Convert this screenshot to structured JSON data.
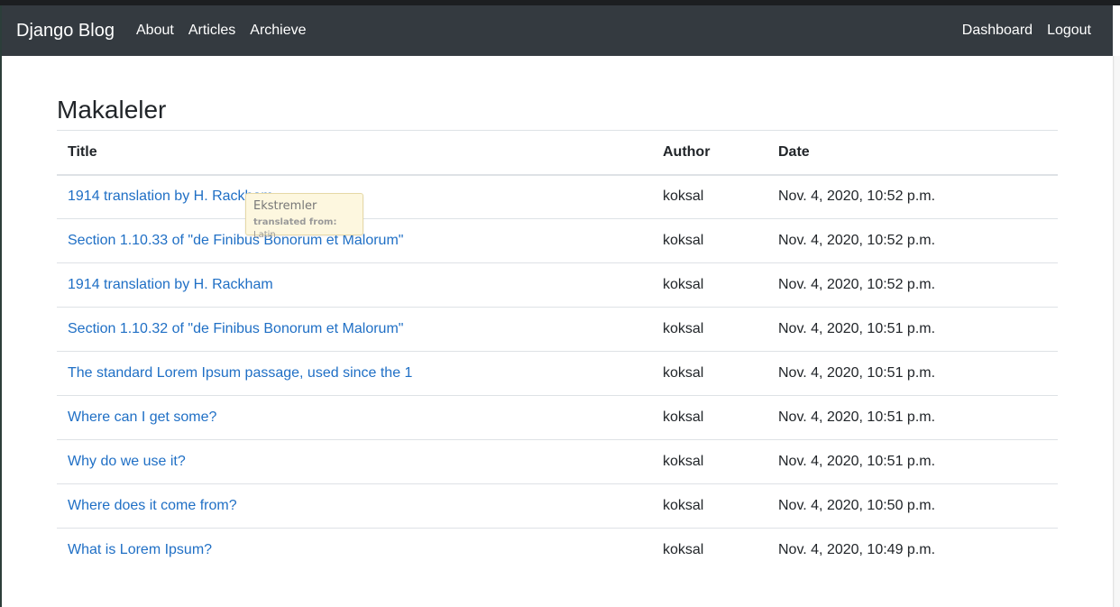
{
  "navbar": {
    "brand": "Django Blog",
    "left_links": [
      "About",
      "Articles",
      "Archieve"
    ],
    "right_links": [
      "Dashboard",
      "Logout"
    ]
  },
  "page": {
    "title": "Makaleler"
  },
  "table": {
    "headers": [
      "Title",
      "Author",
      "Date"
    ],
    "rows": [
      {
        "title": "1914 translation by H. Rackham",
        "author": "koksal",
        "date": "Nov. 4, 2020, 10:52 p.m."
      },
      {
        "title": "Section 1.10.33 of \"de Finibus Bonorum et Malorum\"",
        "author": "koksal",
        "date": "Nov. 4, 2020, 10:52 p.m."
      },
      {
        "title": "1914 translation by H. Rackham",
        "author": "koksal",
        "date": "Nov. 4, 2020, 10:52 p.m."
      },
      {
        "title": "Section 1.10.32 of \"de Finibus Bonorum et Malorum\"",
        "author": "koksal",
        "date": "Nov. 4, 2020, 10:51 p.m."
      },
      {
        "title": "The standard Lorem Ipsum passage, used since the 1",
        "author": "koksal",
        "date": "Nov. 4, 2020, 10:51 p.m."
      },
      {
        "title": "Where can I get some?",
        "author": "koksal",
        "date": "Nov. 4, 2020, 10:51 p.m."
      },
      {
        "title": "Why do we use it?",
        "author": "koksal",
        "date": "Nov. 4, 2020, 10:51 p.m."
      },
      {
        "title": "Where does it come from?",
        "author": "koksal",
        "date": "Nov. 4, 2020, 10:50 p.m."
      },
      {
        "title": "What is Lorem Ipsum?",
        "author": "koksal",
        "date": "Nov. 4, 2020, 10:49 p.m."
      }
    ]
  },
  "tooltip": {
    "translation": "Ekstremler",
    "source_prefix": "translated from:",
    "source_lang": "Latin"
  },
  "colors": {
    "navbar_bg": "#343a40",
    "link": "#1f6fc5",
    "tooltip_bg": "#fdf7df"
  }
}
